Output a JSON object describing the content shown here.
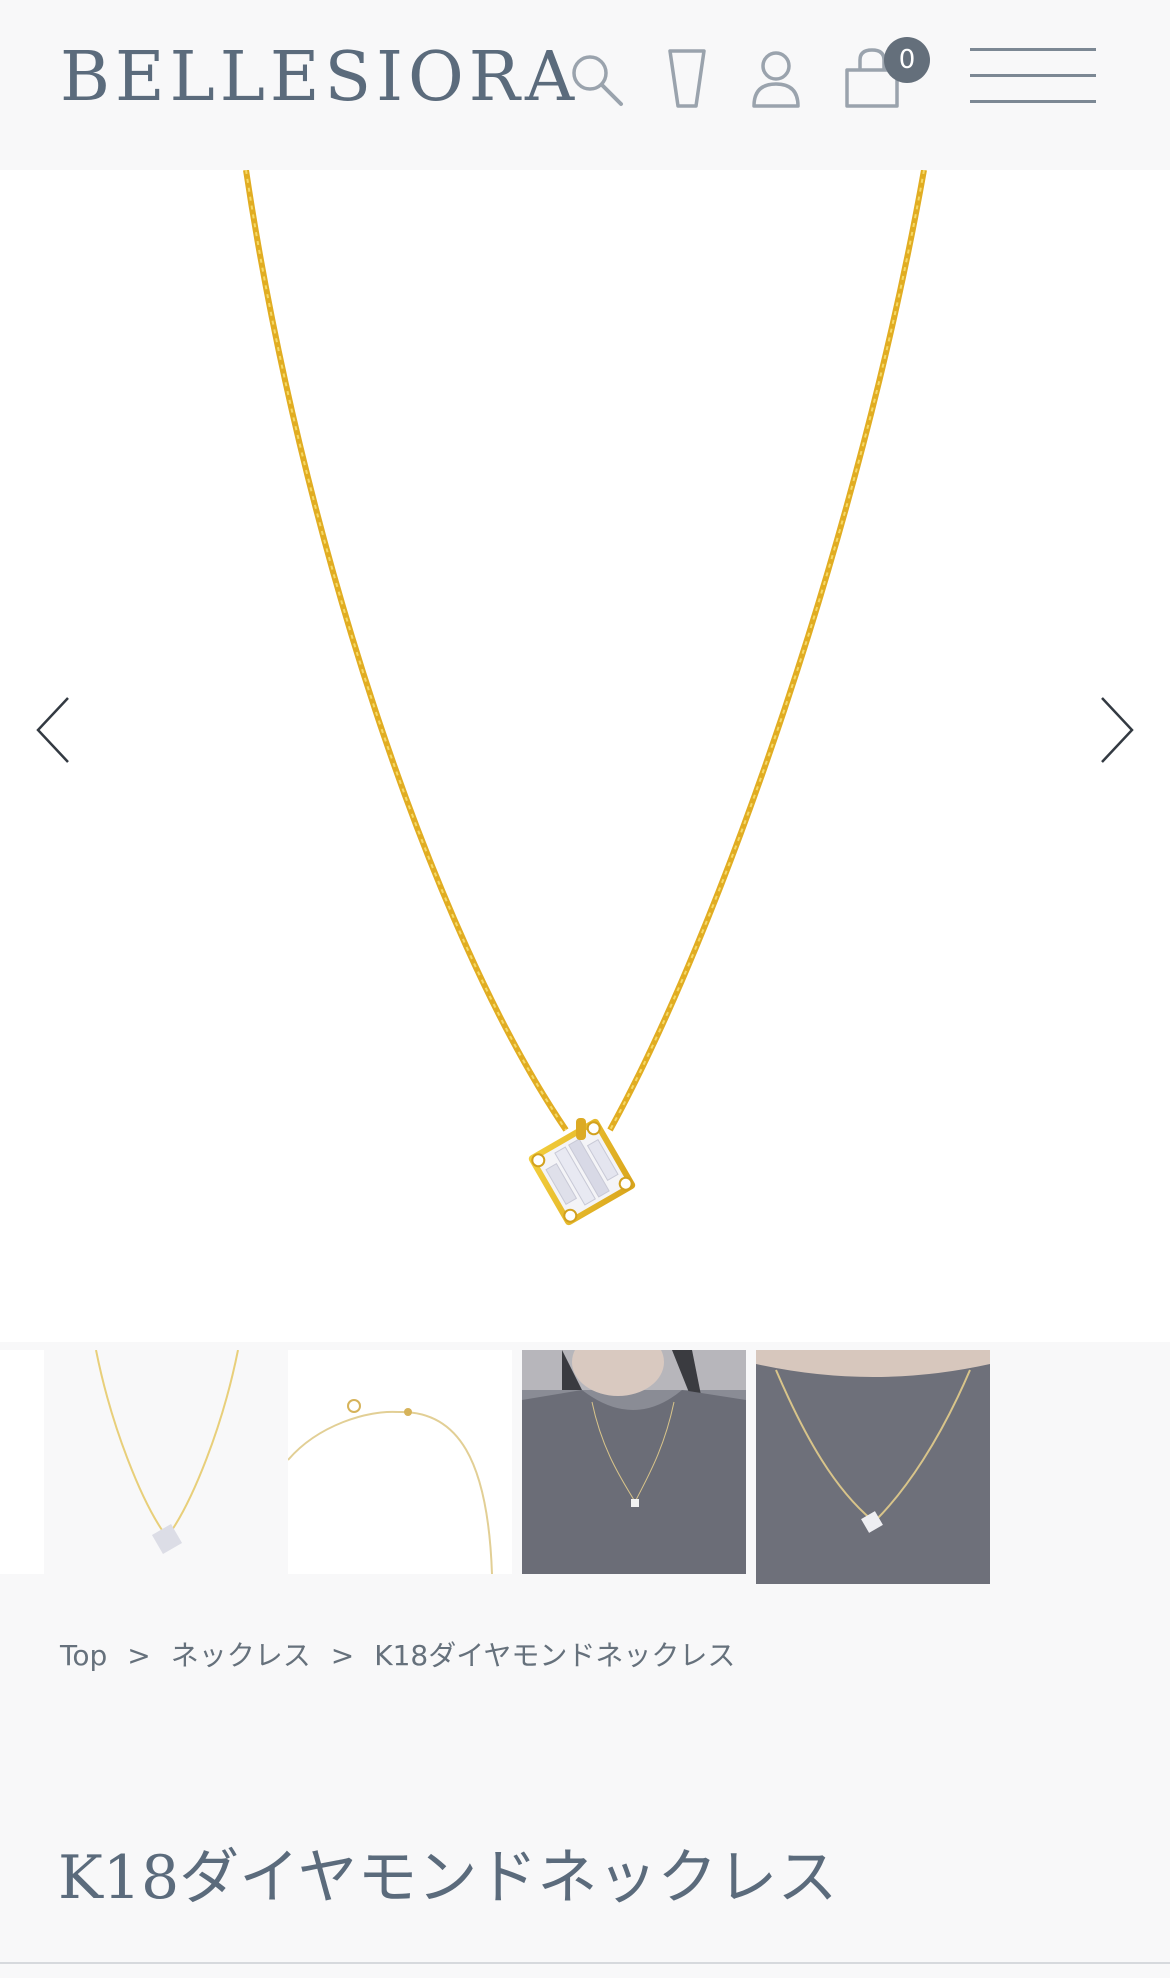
{
  "header": {
    "logo": "BELLESIORA",
    "cart_count": "0",
    "icons": [
      "search-icon",
      "wishlist-icon",
      "account-icon",
      "cart-icon",
      "menu-icon"
    ]
  },
  "gallery": {
    "main_image": "gold box-chain necklace with square baguette diamond pendant",
    "thumbnails": [
      "necklace front view",
      "chain clasp detail",
      "model wearing necklace",
      "close-up on model"
    ]
  },
  "breadcrumb": {
    "items": [
      "Top",
      "ネックレス",
      "K18ダイヤモンドネックレス"
    ],
    "separator": ">"
  },
  "product": {
    "title": "K18ダイヤモンドネックレス"
  },
  "colors": {
    "text": "#5b6b7c",
    "badge": "#646f7b",
    "gold": "#e7b727",
    "background": "#f8f8f9"
  }
}
